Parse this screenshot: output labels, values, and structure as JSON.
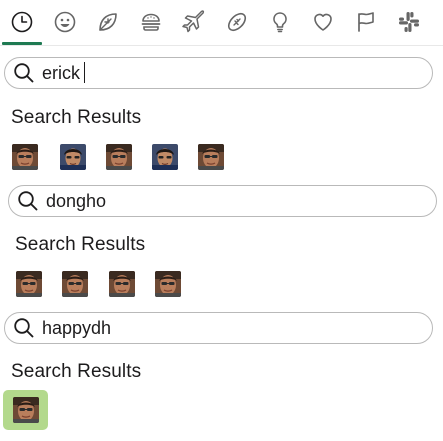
{
  "tabs": [
    {
      "name": "recent",
      "icon": "clock-icon",
      "active": true
    },
    {
      "name": "smileys",
      "icon": "smiley-icon",
      "active": false
    },
    {
      "name": "nature",
      "icon": "leaf-icon",
      "active": false
    },
    {
      "name": "food",
      "icon": "burger-icon",
      "active": false
    },
    {
      "name": "travel",
      "icon": "airplane-icon",
      "active": false
    },
    {
      "name": "activities",
      "icon": "football-icon",
      "active": false
    },
    {
      "name": "objects",
      "icon": "lightbulb-icon",
      "active": false
    },
    {
      "name": "symbols",
      "icon": "heart-icon",
      "active": false
    },
    {
      "name": "flags",
      "icon": "flag-icon",
      "active": false
    },
    {
      "name": "custom",
      "icon": "slack-icon",
      "active": false
    }
  ],
  "colors": {
    "accent": "#1e7a52",
    "selected_bg": "#b3d98c",
    "border": "#b9b9b9"
  },
  "sections": [
    {
      "query": "erick",
      "heading": "Search Results",
      "results": [
        "avatar-1",
        "avatar-2",
        "avatar-3",
        "avatar-4",
        "avatar-5"
      ]
    },
    {
      "query": "dongho",
      "heading": "Search Results",
      "results": [
        "avatar-1",
        "avatar-2",
        "avatar-3",
        "avatar-4"
      ]
    },
    {
      "query": "happydh",
      "heading": "Search Results",
      "results": [
        "avatar-1"
      ]
    }
  ]
}
